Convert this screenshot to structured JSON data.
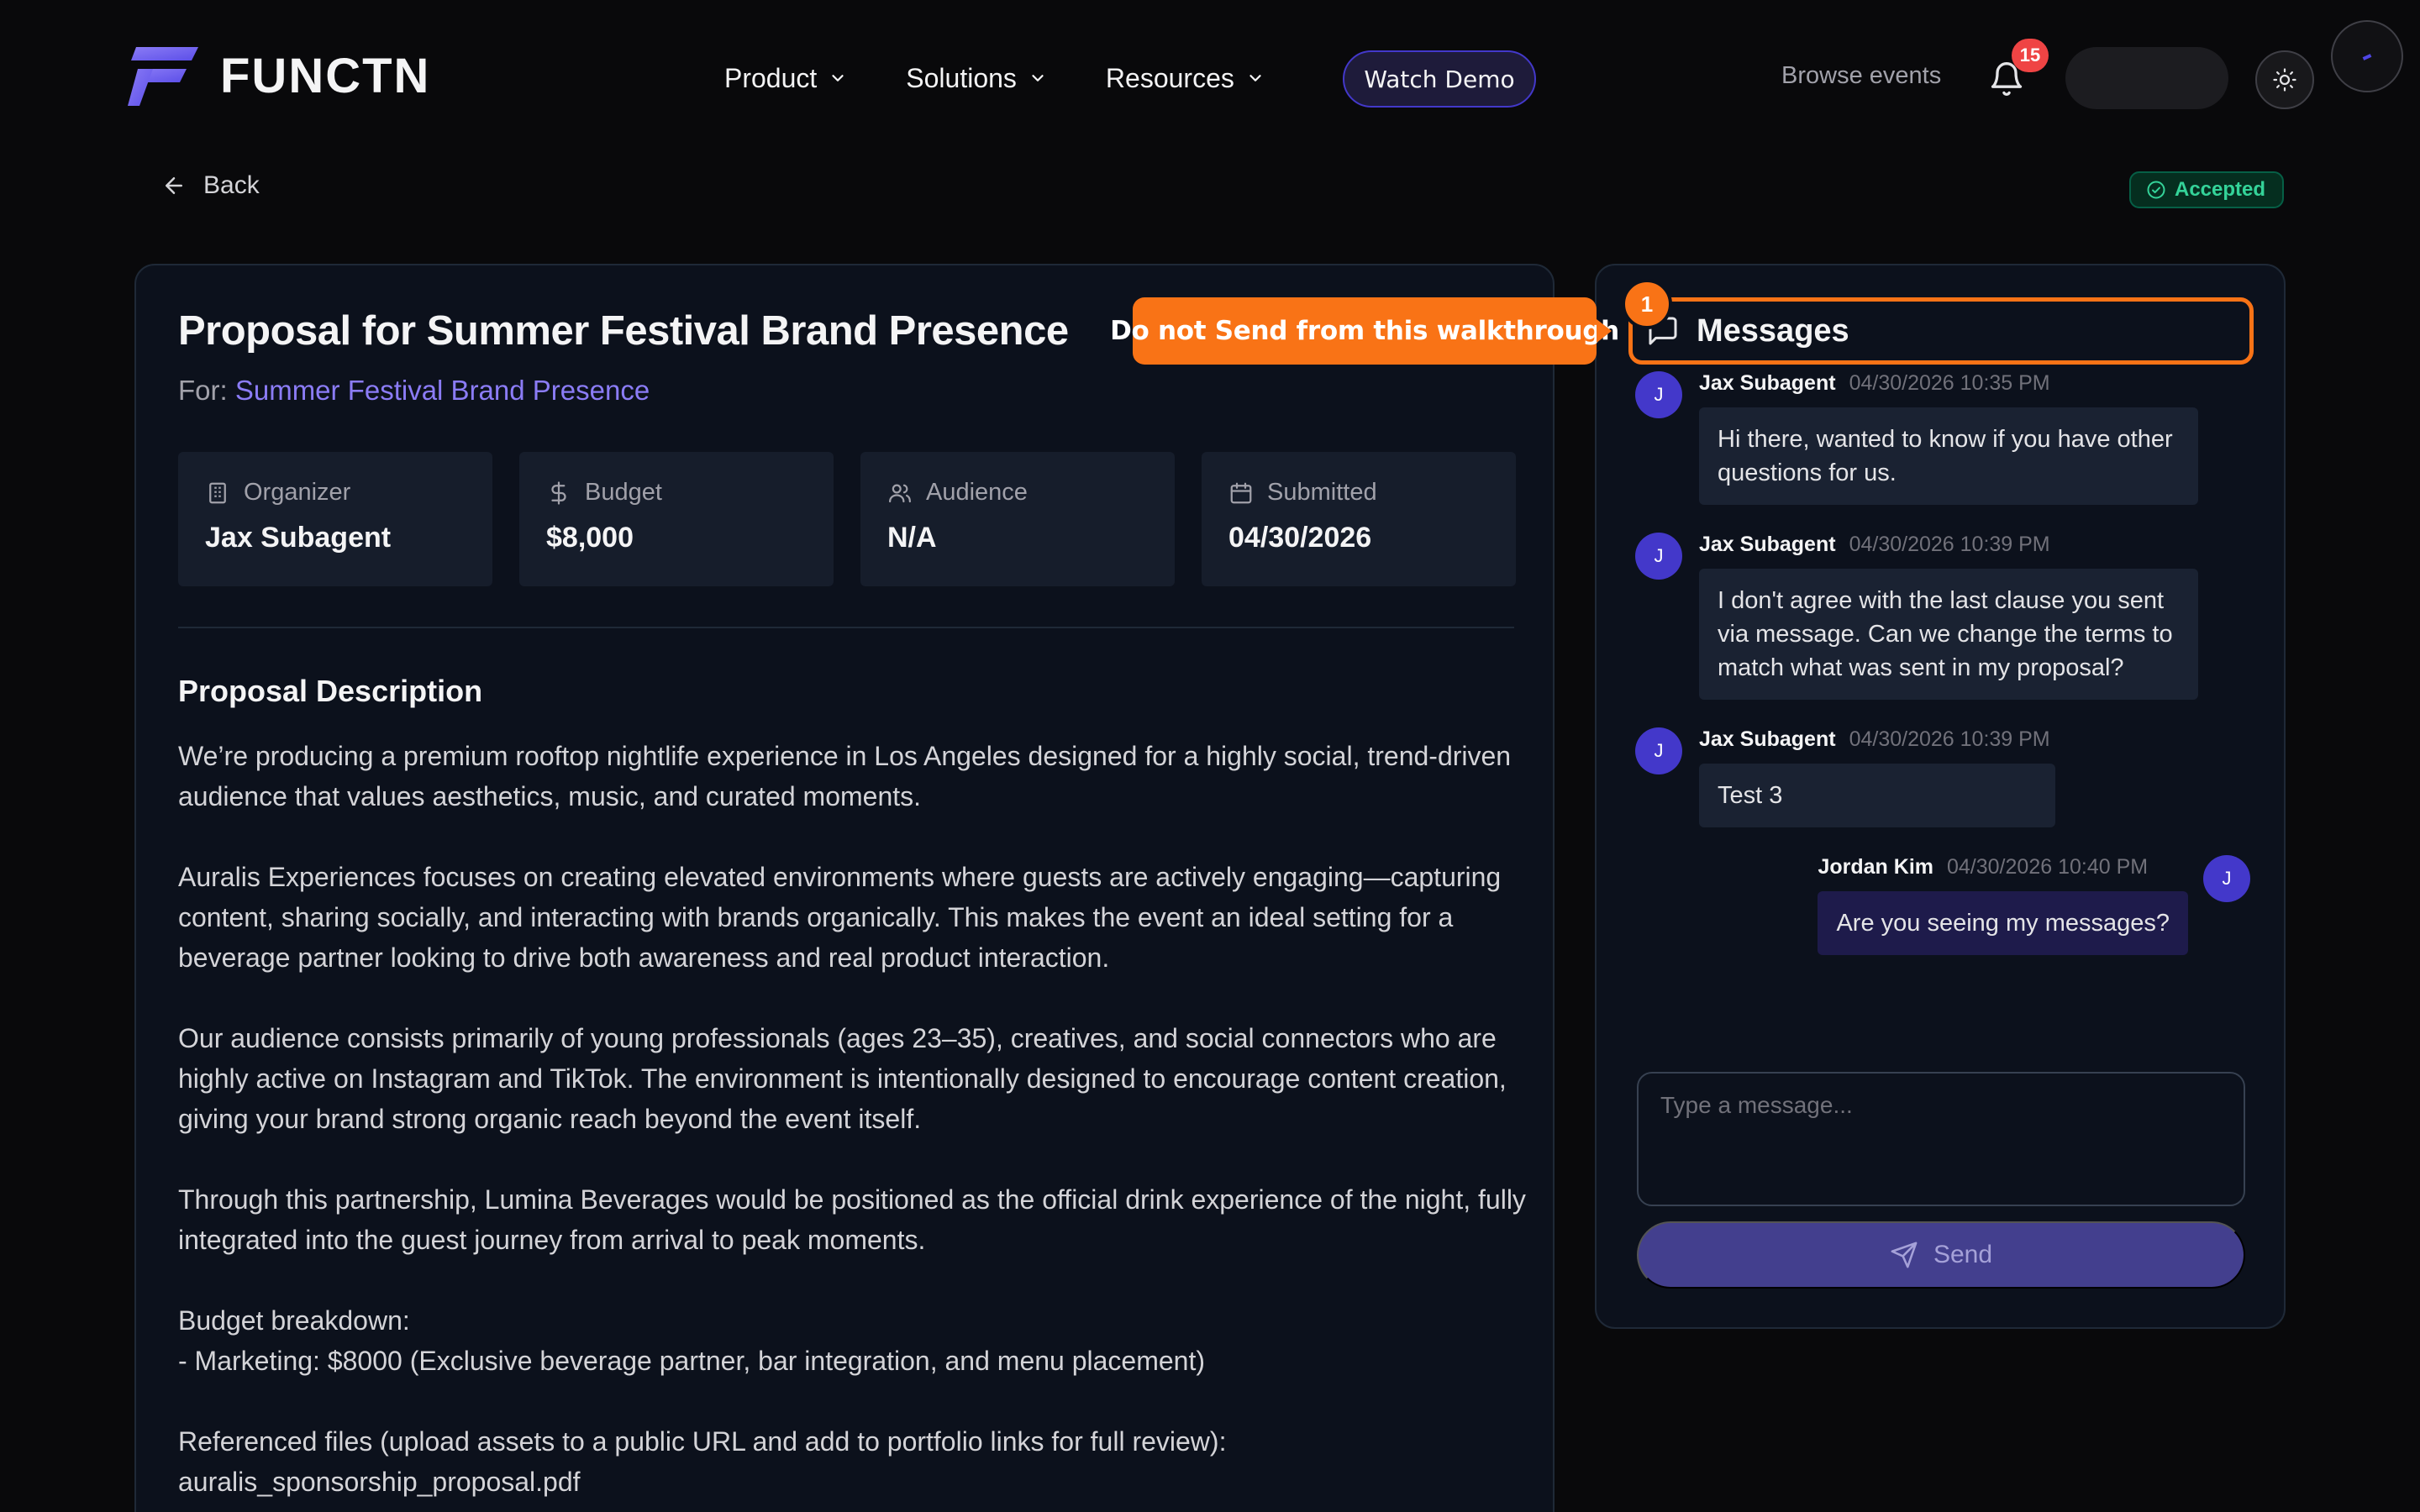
{
  "nav": {
    "logo_text": "FUNCTN",
    "links": [
      "Product",
      "Solutions",
      "Resources"
    ],
    "watch_demo": "Watch Demo",
    "browse_events": "Browse events",
    "notification_count": "15"
  },
  "page": {
    "back_label": "Back",
    "status": "Accepted",
    "title": "Proposal for Summer Festival Brand Presence",
    "for_prefix": "For:",
    "for_link": "Summer Festival Brand Presence"
  },
  "stats": [
    {
      "label": "Organizer",
      "value": "Jax Subagent",
      "icon": "building-icon"
    },
    {
      "label": "Budget",
      "value": "$8,000",
      "icon": "dollar-icon"
    },
    {
      "label": "Audience",
      "value": "N/A",
      "icon": "users-icon"
    },
    {
      "label": "Submitted",
      "value": "04/30/2026",
      "icon": "calendar-icon"
    }
  ],
  "description": {
    "heading": "Proposal Description",
    "paragraphs": [
      "We’re producing a premium rooftop nightlife experience in Los Angeles designed for a highly social, trend-driven audience that values aesthetics, music, and curated moments.",
      "Auralis Experiences focuses on creating elevated environments where guests are actively engaging—capturing content, sharing socially, and interacting with brands organically. This makes the event an ideal setting for a beverage partner looking to drive both awareness and real product interaction.",
      "Our audience consists primarily of young professionals (ages 23–35), creatives, and social connectors who are highly active on Instagram and TikTok. The environment is intentionally designed to encourage content creation, giving your brand strong organic reach beyond the event itself.",
      "Through this partnership, Lumina Beverages would be positioned as the official drink experience of the night, fully integrated into the guest journey from arrival to peak moments.",
      "Budget breakdown:\n- Marketing: $8000 (Exclusive beverage partner, bar integration, and menu placement)",
      "Referenced files (upload assets to a public URL and add to portfolio links for full review):\nauralis_sponsorship_proposal.pdf"
    ]
  },
  "messages": {
    "header": "Messages",
    "items": [
      {
        "initial": "J",
        "name": "Jax Subagent",
        "time": "04/30/2026 10:35 PM",
        "text": "Hi there, wanted to know if you have other questions for us."
      },
      {
        "initial": "J",
        "name": "Jax Subagent",
        "time": "04/30/2026 10:39 PM",
        "text": "I don't agree with the last clause you sent via message. Can we change the terms to match what was sent in my proposal?"
      },
      {
        "initial": "J",
        "name": "Jax Subagent",
        "time": "04/30/2026 10:39 PM",
        "text": "Test 3"
      },
      {
        "initial": "J",
        "name": "Jordan Kim",
        "time": "04/30/2026 10:40 PM",
        "text": "Are you seeing my messages?"
      }
    ],
    "input_placeholder": "Type a message...",
    "send_label": "Send"
  },
  "walkthrough": {
    "tooltip": "Do not Send from this walkthrough",
    "step": "1"
  },
  "colors": {
    "accent": "#f97316",
    "brand": "#6d5ff5",
    "success": "#34d399",
    "danger": "#ef4444"
  }
}
